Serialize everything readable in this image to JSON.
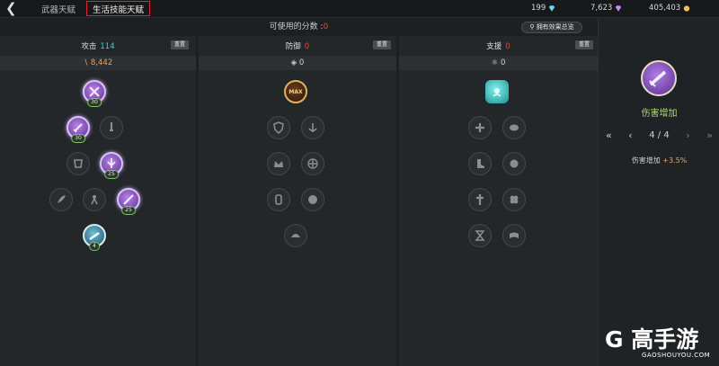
{
  "header": {
    "back_icon": "back-arrow-icon",
    "tabs": [
      {
        "label": "武器天赋"
      },
      {
        "label": "生活技能天赋"
      }
    ],
    "currencies": [
      {
        "icon": "diamond-icon",
        "value": "199",
        "color": "#6fd6ff"
      },
      {
        "icon": "purple-gem-icon",
        "value": "7,623",
        "color": "#c98aff"
      },
      {
        "icon": "gold-coin-icon",
        "value": "405,403",
        "color": "#f2c14a"
      }
    ]
  },
  "points": {
    "label": "可使用的分数 :",
    "value": "0"
  },
  "summary_button": "拥有效果总览",
  "columns": [
    {
      "title": "攻击",
      "count": "114",
      "count_color": "#3fd1c0",
      "reset": "重置",
      "stat_icon": "sword-icon",
      "stat": "8,442",
      "stat_color": "#e5a463"
    },
    {
      "title": "防御",
      "count": "0",
      "count_color": "#e0463b",
      "reset": "重置",
      "stat_icon": "shield-icon",
      "stat": "0",
      "stat_color": "#d9d9d9"
    },
    {
      "title": "支援",
      "count": "0",
      "count_color": "#e0463b",
      "reset": "重置",
      "stat_icon": "support-icon",
      "stat": "0",
      "stat_color": "#d9d9d9"
    }
  ],
  "attack_nodes": {
    "n1": {
      "level": "30"
    },
    "n2": {
      "level": "30"
    },
    "n4": {
      "level": "25"
    },
    "n7": {
      "level": "25"
    },
    "n8": {
      "level": "4"
    }
  },
  "defense_nodes": {
    "max_label": "MAX"
  },
  "detail": {
    "name": "伤害增加",
    "page": "4 / 4",
    "effect_label": "伤害增加",
    "effect_value": "+3.5%"
  },
  "watermark": {
    "logo": "G 高手游",
    "url": "GAOSHOUYOU.COM"
  }
}
